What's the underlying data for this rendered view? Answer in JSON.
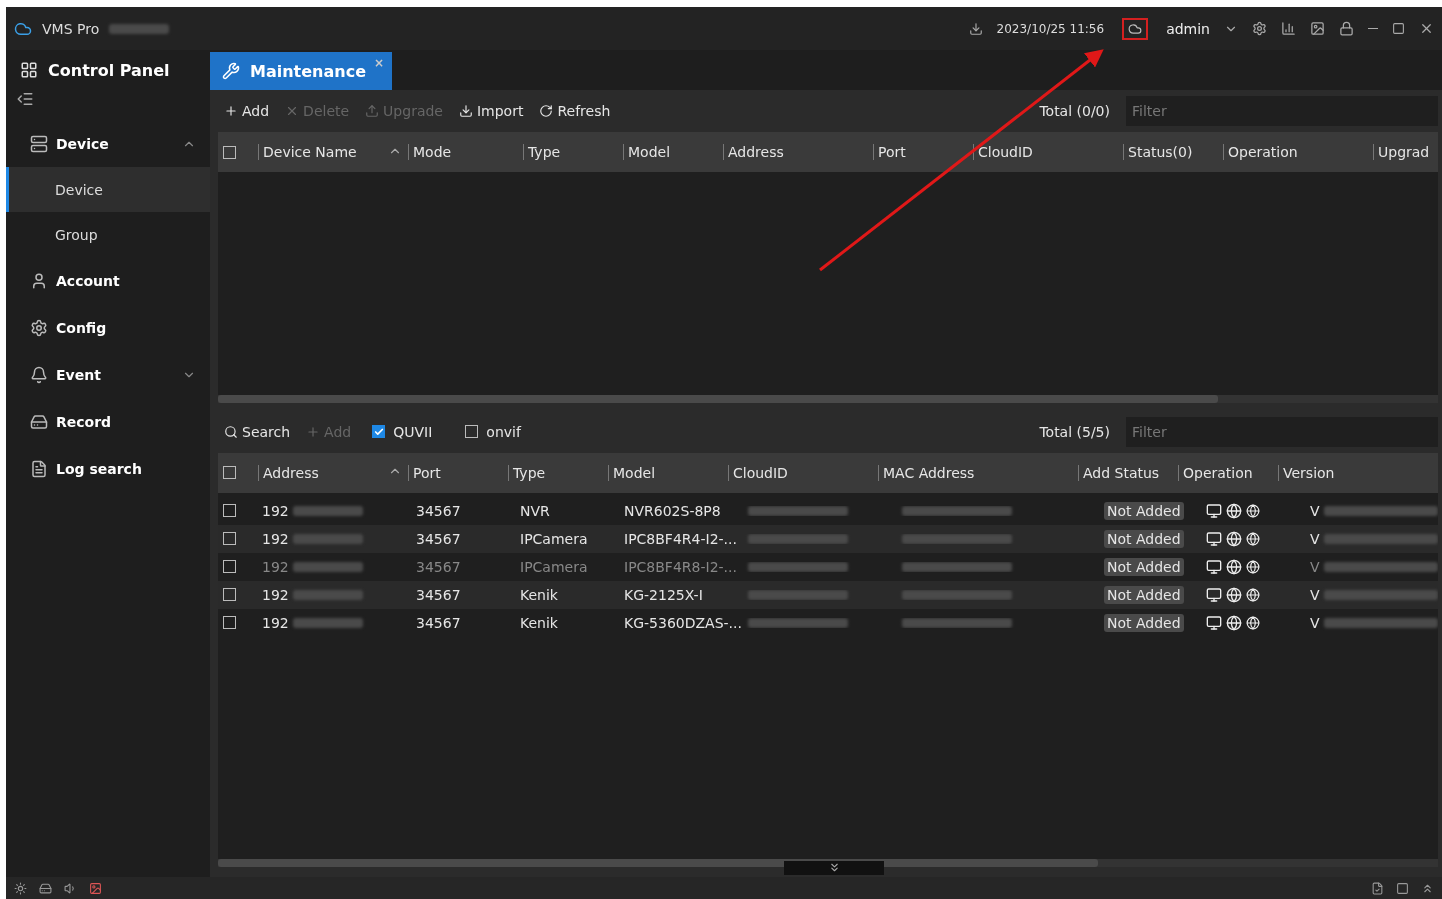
{
  "window": {
    "title": "VMS Pro",
    "datetime": "2023/10/25 11:56",
    "user": "admin"
  },
  "top_tab": {
    "label": "Control Panel"
  },
  "tabs": [
    {
      "label": "Maintenance",
      "selected": true,
      "close": "×"
    }
  ],
  "sidebar": {
    "items": [
      {
        "label": "Device",
        "expanded": true,
        "children": [
          {
            "label": "Device",
            "selected": true
          },
          {
            "label": "Group",
            "selected": false
          }
        ]
      },
      {
        "label": "Account"
      },
      {
        "label": "Config"
      },
      {
        "label": "Event",
        "expanded": false
      },
      {
        "label": "Record"
      },
      {
        "label": "Log search"
      }
    ]
  },
  "device_list": {
    "toolbar": [
      {
        "label": "Add",
        "disabled": false
      },
      {
        "label": "Delete",
        "disabled": true
      },
      {
        "label": "Upgrade",
        "disabled": true
      },
      {
        "label": "Import",
        "disabled": false
      },
      {
        "label": "Refresh",
        "disabled": false
      }
    ],
    "total": "Total (0/0)",
    "filter": {
      "placeholder": "Filter"
    },
    "select_all": {
      "checked": false
    },
    "columns": [
      "Device Name",
      "Mode",
      "Type",
      "Model",
      "Address",
      "Port",
      "CloudID",
      "Status(0)",
      "Operation",
      "Upgrad"
    ]
  },
  "search_list": {
    "toolbar": [
      {
        "kind": "button",
        "label": "Search",
        "disabled": false
      },
      {
        "kind": "button",
        "label": "Add",
        "disabled": true
      },
      {
        "kind": "checkbox",
        "label": "QUVII",
        "checked": true
      },
      {
        "kind": "checkbox",
        "label": "onvif",
        "checked": false
      }
    ],
    "total": "Total (5/5)",
    "filter": {
      "placeholder": "Filter"
    },
    "select_all": {
      "checked": false
    },
    "columns": [
      "Address",
      "Port",
      "Type",
      "Model",
      "CloudID",
      "MAC Address",
      "Add Status",
      "Operation",
      "Version"
    ],
    "rows": [
      {
        "address": "192",
        "port": "34567",
        "type": "NVR",
        "model": "NVR602S-8P8",
        "status": "Not Added",
        "version": "V",
        "dimmed": false,
        "checked": false
      },
      {
        "address": "192",
        "port": "34567",
        "type": "IPCamera",
        "model": "IPC8BF4R4-I2-...",
        "status": "Not Added",
        "version": "V",
        "dimmed": false,
        "checked": false
      },
      {
        "address": "192",
        "port": "34567",
        "type": "IPCamera",
        "model": "IPC8BF4R8-I2-...",
        "status": "Not Added",
        "version": "V",
        "dimmed": true,
        "checked": false
      },
      {
        "address": "192",
        "port": "34567",
        "type": "Kenik",
        "model": "KG-2125X-I",
        "status": "Not Added",
        "version": "V",
        "dimmed": false,
        "checked": false
      },
      {
        "address": "192",
        "port": "34567",
        "type": "Kenik",
        "model": "KG-5360DZAS-...",
        "status": "Not Added",
        "version": "V",
        "dimmed": false,
        "checked": false
      }
    ]
  }
}
